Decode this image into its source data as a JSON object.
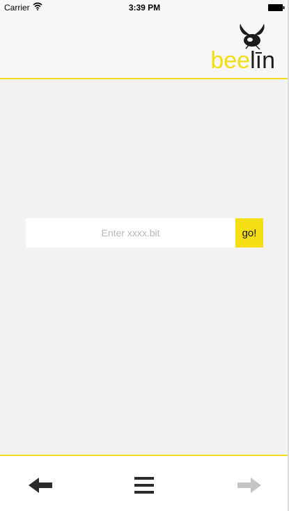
{
  "status_bar": {
    "carrier": "Carrier",
    "time": "3:39 PM",
    "icons": [
      "wifi-icon",
      "battery-icon"
    ]
  },
  "header": {
    "logo_part1": "bee",
    "logo_part2": "līn",
    "logo_icon": "bee-icon"
  },
  "search": {
    "placeholder": "Enter xxxx.bit",
    "value": "",
    "go_label": "go!"
  },
  "toolbar": {
    "items": [
      "back-arrow-icon",
      "menu-icon",
      "forward-arrow-icon"
    ],
    "forward_enabled": false
  },
  "colors": {
    "accent": "#f5de14",
    "background": "#f1f2f1",
    "header_background": "#f6f7f6",
    "divider": "#f5d820"
  }
}
